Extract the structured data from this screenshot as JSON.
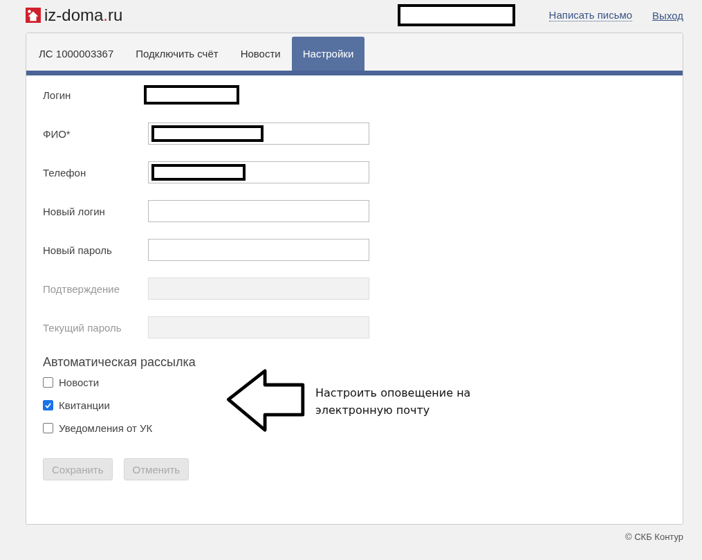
{
  "header": {
    "logo": {
      "name": "iz-doma",
      "dot": ".",
      "tld": "ru"
    },
    "user_redacted": true,
    "links": [
      {
        "label": "Написать письмо",
        "kind": "dotted"
      },
      {
        "label": "Выход",
        "kind": "underline"
      }
    ]
  },
  "tabs": [
    {
      "label": "ЛС 1000003367",
      "selected": false
    },
    {
      "label": "Подключить счёт",
      "selected": false
    },
    {
      "label": "Новости",
      "selected": false
    },
    {
      "label": "Настройки",
      "selected": true
    }
  ],
  "fields": [
    {
      "label": "Логин",
      "kind": "static",
      "redacted": true,
      "disabled": false
    },
    {
      "label": "ФИО*",
      "kind": "input",
      "redacted": true,
      "disabled": false
    },
    {
      "label": "Телефон",
      "kind": "input",
      "redacted": true,
      "disabled": false
    },
    {
      "label": "Новый логин",
      "kind": "input",
      "redacted": false,
      "disabled": false
    },
    {
      "label": "Новый пароль",
      "kind": "input",
      "redacted": false,
      "disabled": false
    },
    {
      "label": "Подтверждение",
      "kind": "input",
      "redacted": false,
      "disabled": true
    },
    {
      "label": "Текущий пароль",
      "kind": "input",
      "redacted": false,
      "disabled": true
    }
  ],
  "mailing": {
    "title": "Автоматическая рассылка",
    "options": [
      {
        "label": "Новости",
        "checked": false
      },
      {
        "label": "Квитанции",
        "checked": true
      },
      {
        "label": "Уведомления от УК",
        "checked": false
      }
    ]
  },
  "annotation": {
    "text": "Настроить оповещение на электронную почту"
  },
  "buttons": [
    {
      "label": "Сохранить",
      "disabled": true
    },
    {
      "label": "Отменить",
      "disabled": true
    }
  ],
  "footer": {
    "copyright": "© СКБ Контур"
  }
}
